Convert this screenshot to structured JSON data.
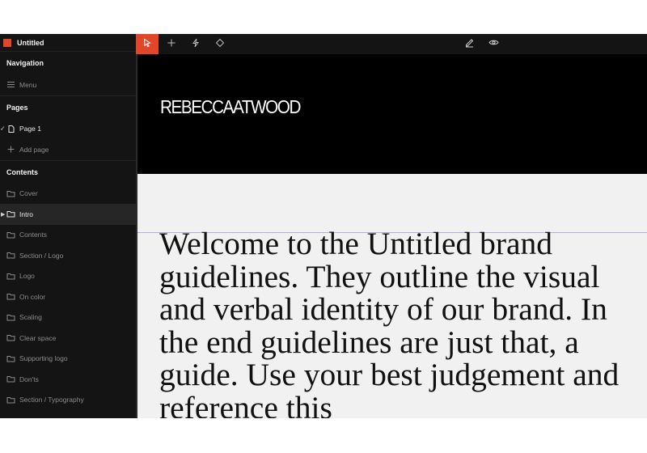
{
  "app": {
    "title": "Untitled",
    "accent": "#e2462a"
  },
  "sidebar": {
    "navigation": {
      "header": "Navigation",
      "items": [
        {
          "label": "Menu",
          "icon": "menu-icon"
        }
      ]
    },
    "pages": {
      "header": "Pages",
      "items": [
        {
          "label": "Page 1",
          "icon": "page-icon",
          "selected": true
        }
      ],
      "add_label": "Add page"
    },
    "contents": {
      "header": "Contents",
      "items": [
        {
          "label": "Cover"
        },
        {
          "label": "Intro",
          "active": true
        },
        {
          "label": "Contents"
        },
        {
          "label": "Section / Logo"
        },
        {
          "label": "Logo"
        },
        {
          "label": "On color"
        },
        {
          "label": "Scaling"
        },
        {
          "label": "Clear space"
        },
        {
          "label": "Supporting logo"
        },
        {
          "label": "Don'ts"
        },
        {
          "label": "Section / Typography"
        }
      ]
    }
  },
  "toolbar": {
    "left_tools": [
      "select-tool-icon",
      "add-icon",
      "interaction-icon",
      "component-icon"
    ],
    "right_tools": [
      "edit-icon",
      "preview-eye-icon"
    ],
    "active_tool": "select-tool-icon"
  },
  "canvas": {
    "logo_text": "REBECCAATWOOD",
    "intro_text": "Welcome to the Untitled brand guidelines. They outline the visual and verbal identity of our brand. In the end guidelines are just that, a guide. Use your best judgement and reference this"
  }
}
